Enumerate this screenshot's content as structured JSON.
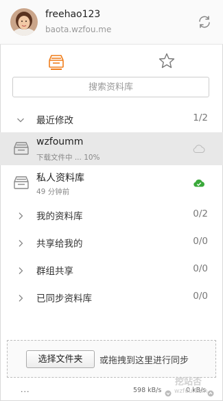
{
  "header": {
    "user_name": "freehao123",
    "server_host": "baota.wzfou.me"
  },
  "tabs": [
    {
      "name": "libraries",
      "icon": "libraries-icon",
      "active": true
    },
    {
      "name": "starred",
      "icon": "star-icon",
      "active": false
    }
  ],
  "search": {
    "placeholder": "搜索资料库"
  },
  "recent": {
    "label": "最近修改",
    "count": "1/2"
  },
  "libraries": [
    {
      "name": "wzfoumm",
      "sub": "下载文件中 ... 10%",
      "progress_percent": 10,
      "status_icon": "cloud-outline-icon",
      "selected": true
    },
    {
      "name": "私人资料库",
      "sub": "49 分钟前",
      "status_icon": "cloud-check-icon",
      "selected": false
    }
  ],
  "groups": [
    {
      "label": "我的资料库",
      "count": "0/2"
    },
    {
      "label": "共享给我的",
      "count": "0/0"
    },
    {
      "label": "群组共享",
      "count": "0/0"
    },
    {
      "label": "已同步资料库",
      "count": "0/0"
    }
  ],
  "footer": {
    "choose_button": "选择文件夹",
    "drop_hint": "或拖拽到这里进行同步"
  },
  "status": {
    "dots": "...",
    "download_speed": "598 kB/s",
    "upload_speed": "0 kB/s"
  },
  "watermark": {
    "text": "挖站否",
    "url": "wzfou.com"
  },
  "colors": {
    "accent": "#f07d1a",
    "synced": "#3aa93a",
    "selected_row": "#e8e8e8"
  }
}
